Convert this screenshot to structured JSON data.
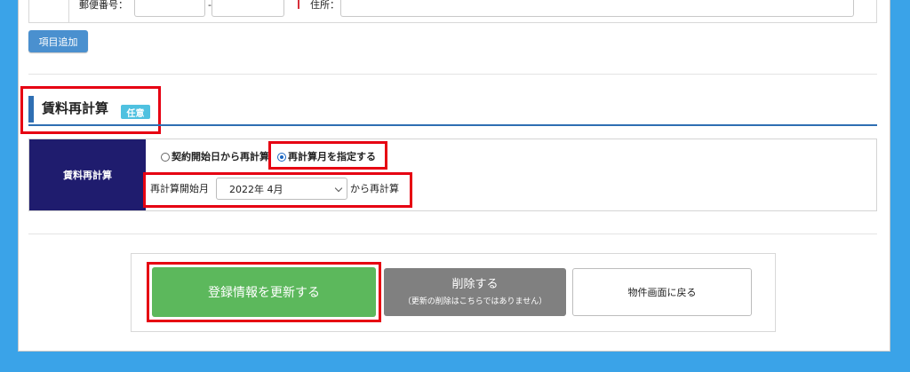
{
  "address_row": {
    "postal_label": "郵便番号：",
    "postal_separator": "-",
    "address_label": "住所："
  },
  "add_item_button": "項目追加",
  "section": {
    "title": "賃料再計算",
    "badge": "任意"
  },
  "rent_recalc": {
    "row_header": "賃料再計算",
    "options": [
      {
        "label": "契約開始日から再計算",
        "selected": false
      },
      {
        "label": "再計算月を指定する",
        "selected": true
      }
    ],
    "month_label": "再計算開始月",
    "month_value": "2022年 4月",
    "month_suffix": "から再計算"
  },
  "buttons": {
    "update": "登録情報を更新する",
    "delete_main": "削除する",
    "delete_sub": "（更新の削除はこちらではありません）",
    "back": "物件画面に戻る"
  },
  "colors": {
    "background": "#3aa3e8",
    "header_cell": "#1f1c6e",
    "accent": "#2f6fb3",
    "badge": "#4fc1e0",
    "update_button": "#5cb85c",
    "delete_button": "#808080",
    "highlight": "#e60012"
  }
}
